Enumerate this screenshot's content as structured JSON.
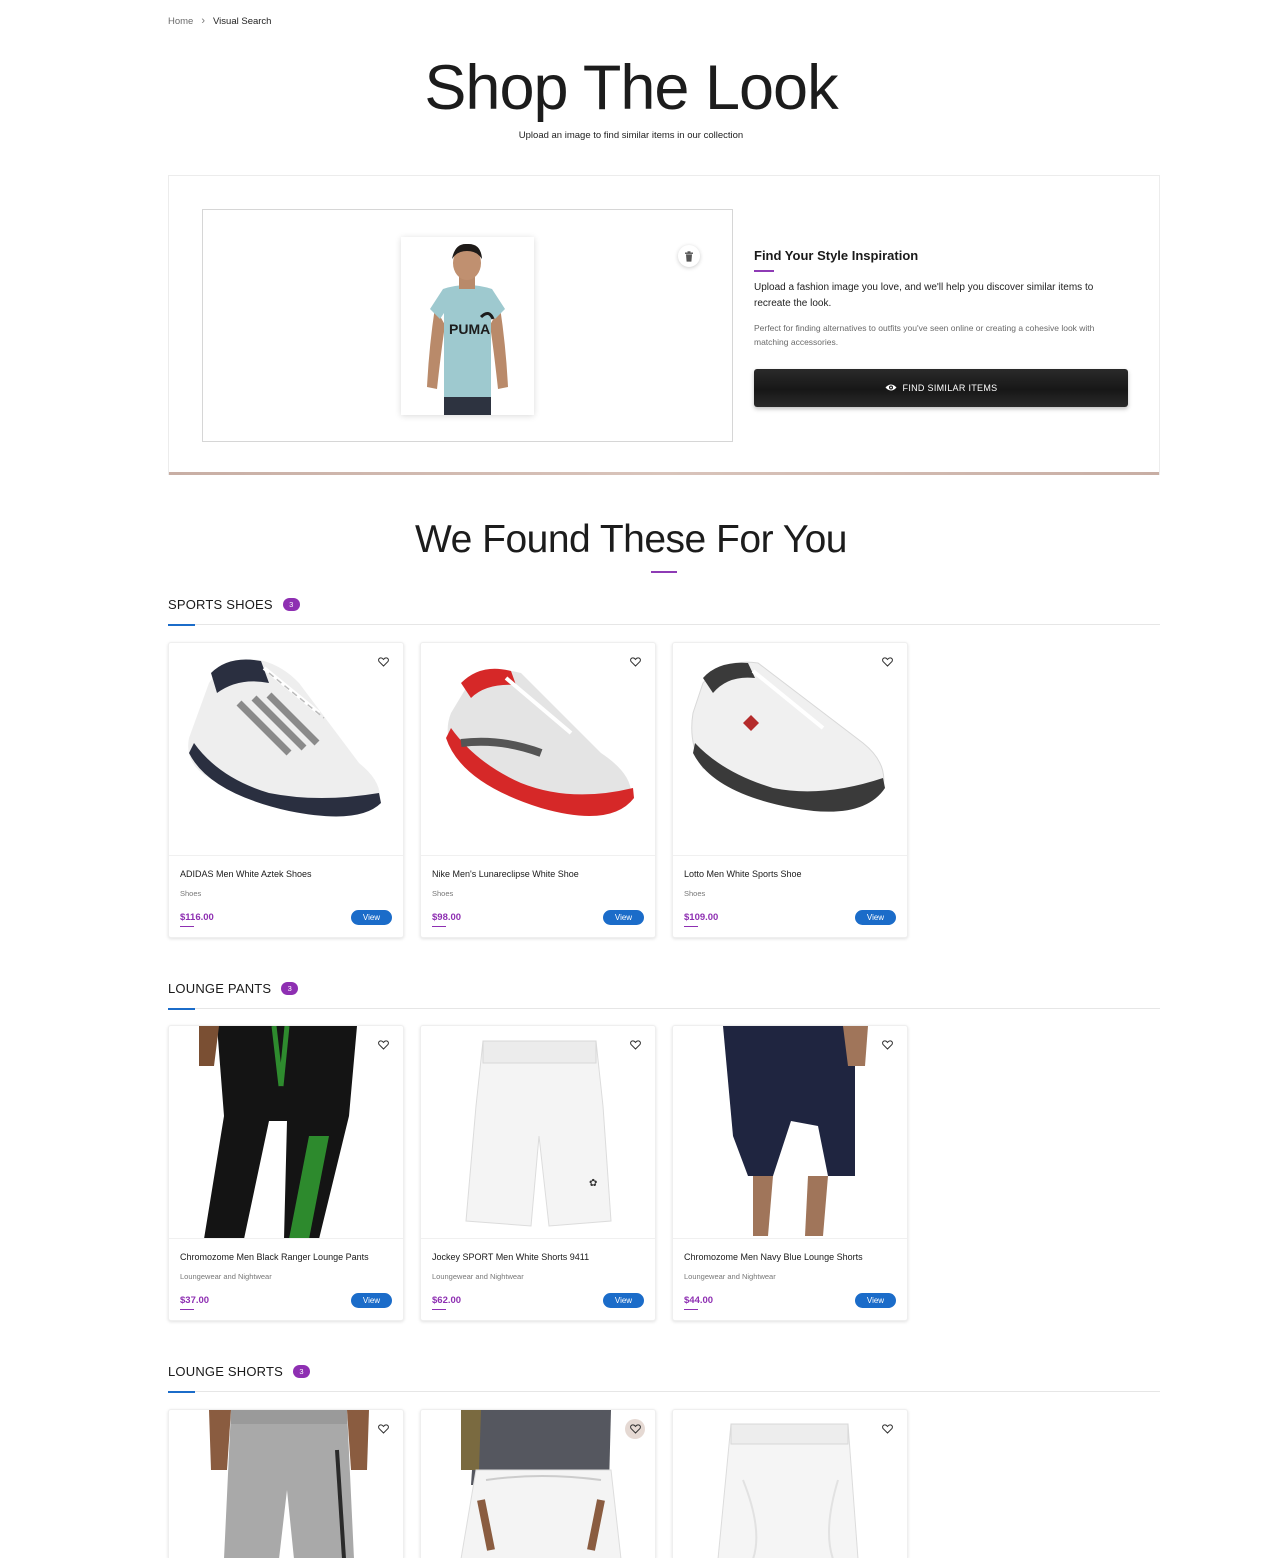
{
  "breadcrumb": {
    "home": "Home",
    "separator": "›",
    "current": "Visual Search"
  },
  "hero": {
    "title": "Shop The Look",
    "subtitle": "Upload an image to find similar items in our collection"
  },
  "upload": {
    "heading": "Find Your Style Inspiration",
    "description": "Upload a fashion image you love, and we'll help you discover similar items to recreate the look.",
    "note": "Perfect for finding alternatives to outfits you've seen online or creating a cohesive look with matching accessories.",
    "button_label": "FIND SIMILAR ITEMS",
    "preview_icon": "delete-icon"
  },
  "results": {
    "title": "We Found These For You",
    "view_label": "View",
    "sections": [
      {
        "name": "SPORTS SHOES",
        "count": "3",
        "products": [
          {
            "name": "ADIDAS Men White Aztek Shoes",
            "category": "Shoes",
            "price": "$116.00"
          },
          {
            "name": "Nike Men's Lunareclipse White Shoe",
            "category": "Shoes",
            "price": "$98.00"
          },
          {
            "name": "Lotto Men White Sports Shoe",
            "category": "Shoes",
            "price": "$109.00"
          }
        ]
      },
      {
        "name": "LOUNGE PANTS",
        "count": "3",
        "products": [
          {
            "name": "Chromozome Men Black Ranger Lounge Pants",
            "category": "Loungewear and Nightwear",
            "price": "$37.00"
          },
          {
            "name": "Jockey SPORT Men White Shorts 9411",
            "category": "Loungewear and Nightwear",
            "price": "$62.00"
          },
          {
            "name": "Chromozome Men Navy Blue Lounge Shorts",
            "category": "Loungewear and Nightwear",
            "price": "$44.00"
          }
        ]
      },
      {
        "name": "LOUNGE SHORTS",
        "count": "3",
        "products": [
          {},
          {},
          {}
        ]
      }
    ]
  },
  "colors": {
    "accent_purple": "#8e2fb2",
    "accent_blue": "#1b6cc9",
    "button_dark": "#1c1c1c"
  }
}
